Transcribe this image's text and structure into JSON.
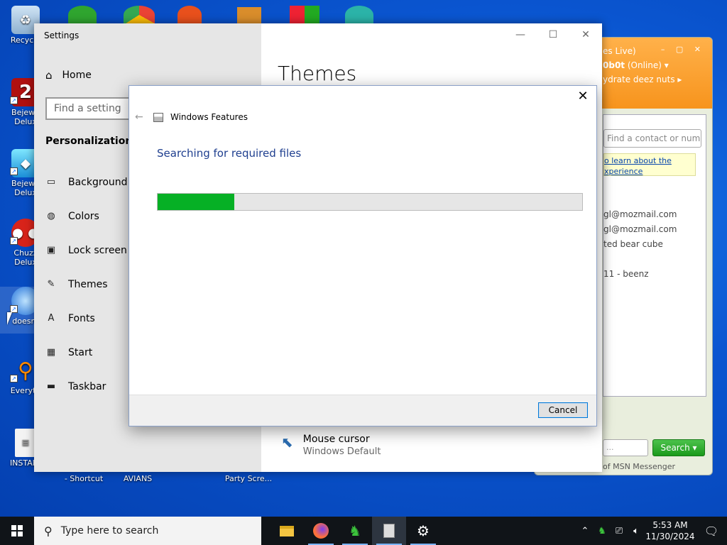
{
  "desktop": {
    "icons": [
      {
        "label": "Recycle",
        "icon": "recycle-bin-icon"
      },
      {
        "label": "Bejewe\nDelux",
        "icon": "bejeweled2-icon"
      },
      {
        "label": "Bejewe\nDelux",
        "icon": "bejeweled-icon"
      },
      {
        "label": "Chuzz\nDelux",
        "icon": "chuzzle-icon"
      },
      {
        "label": "doesnt",
        "icon": "app-icon"
      },
      {
        "label": "Everyth",
        "icon": "everything-search-icon"
      },
      {
        "label": "INSTALL",
        "icon": "install-doc-icon"
      }
    ],
    "bottom_labels": [
      "- Shortcut",
      "AVIANS",
      "Party Scre..."
    ]
  },
  "msn": {
    "status_line1": "es Live)",
    "name": "0b0t",
    "status": "(Online)",
    "message": "ydrate deez nuts",
    "find_placeholder": "Find a contact or numbe",
    "ad_line1": "o learn about the",
    "ad_line2": "xperience",
    "contacts": [
      "",
      "gl@mozmail.com",
      "gl@mozmail.com",
      "ted bear cube",
      "",
      "11 - beenz"
    ],
    "search_placeholder": "...",
    "search_button": "Search",
    "footer": "of MSN Messenger"
  },
  "settings": {
    "window_title": "Settings",
    "home": "Home",
    "find_placeholder": "Find a setting",
    "section": "Personalization",
    "nav": [
      {
        "label": "Background",
        "icon": "background-icon"
      },
      {
        "label": "Colors",
        "icon": "palette-icon"
      },
      {
        "label": "Lock screen",
        "icon": "lock-screen-icon"
      },
      {
        "label": "Themes",
        "icon": "themes-icon"
      },
      {
        "label": "Fonts",
        "icon": "fonts-icon"
      },
      {
        "label": "Start",
        "icon": "start-icon"
      },
      {
        "label": "Taskbar",
        "icon": "taskbar-icon"
      }
    ],
    "page_title": "Themes",
    "mouse_cursor_title": "Mouse cursor",
    "mouse_cursor_value": "Windows Default"
  },
  "dialog": {
    "title": "Windows Features",
    "message": "Searching for required files",
    "progress": 0.18,
    "cancel": "Cancel"
  },
  "taskbar": {
    "search_placeholder": "Type here to search",
    "time": "5:53 AM",
    "date": "11/30/2024"
  },
  "colors": {
    "progress_green": "#06b025",
    "desktop_blue": "#0a55d0",
    "msn_orange": "#f7941d"
  }
}
